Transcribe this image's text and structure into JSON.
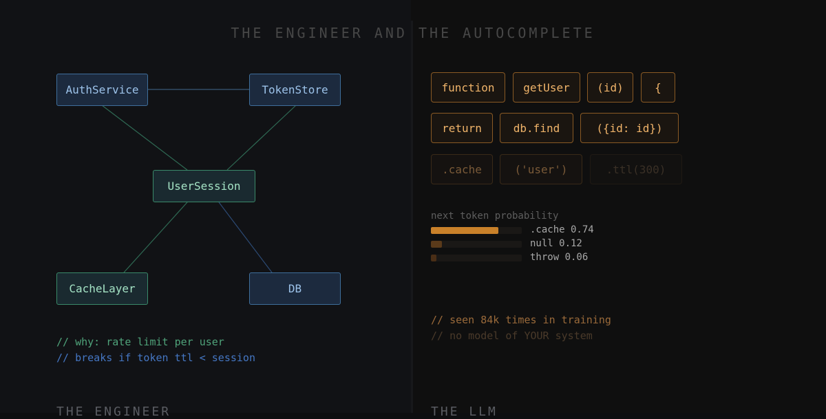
{
  "title": "THE ENGINEER AND THE AUTOCOMPLETE",
  "engineer": {
    "label": "THE ENGINEER",
    "nodes": {
      "auth_service": "AuthService",
      "token_store": "TokenStore",
      "user_session": "UserSession",
      "cache_layer": "CacheLayer",
      "db": "DB"
    },
    "comments": [
      "// why: rate limit per user",
      "// breaks if token ttl < session"
    ]
  },
  "llm": {
    "label": "THE LLM",
    "tokens": [
      [
        "function",
        "getUser",
        "(id)",
        "{"
      ],
      [
        "return",
        "db.find",
        "({id: id})"
      ],
      [
        ".cache",
        "('user')",
        ".ttl(300)"
      ]
    ],
    "probability": {
      "title": "next token probability",
      "items": [
        {
          "label": ".cache 0.74",
          "value": 0.74
        },
        {
          "label": "null 0.12",
          "value": 0.12
        },
        {
          "label": "throw 0.06",
          "value": 0.06
        }
      ]
    },
    "comments": [
      "// seen 84k times in training",
      "// no model of YOUR system"
    ]
  },
  "colors": {
    "accent_orange": "#c9812a",
    "comment_green": "#4fa37a",
    "comment_blue": "#4577c4",
    "node_blue_border": "#3f6f9c",
    "node_green_border": "#3a8a6a"
  }
}
